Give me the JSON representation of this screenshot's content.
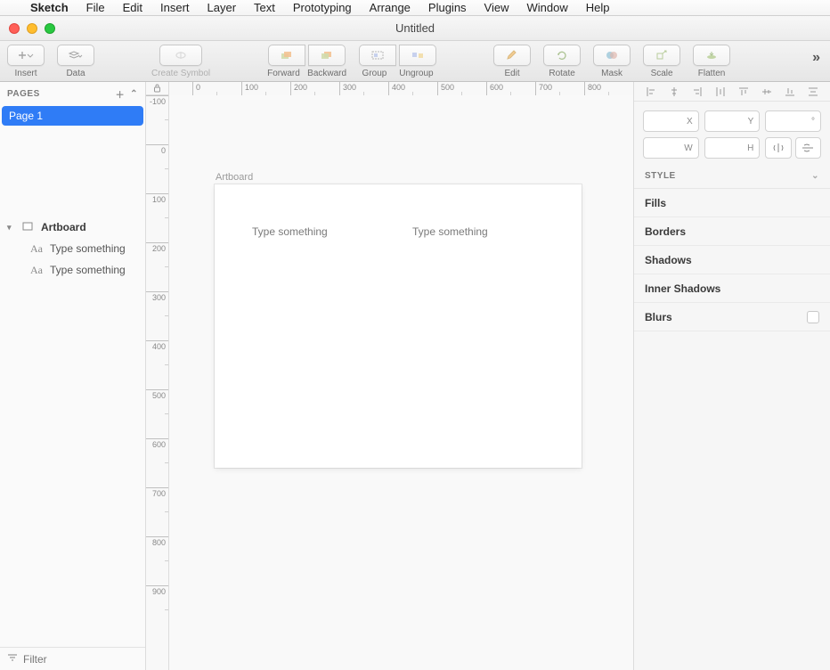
{
  "menubar": {
    "app": "Sketch",
    "items": [
      "File",
      "Edit",
      "Insert",
      "Layer",
      "Text",
      "Prototyping",
      "Arrange",
      "Plugins",
      "View",
      "Window",
      "Help"
    ]
  },
  "window": {
    "title": "Untitled"
  },
  "toolbar": {
    "insert": "Insert",
    "data": "Data",
    "create_symbol": "Create Symbol",
    "forward": "Forward",
    "backward": "Backward",
    "group": "Group",
    "ungroup": "Ungroup",
    "edit": "Edit",
    "rotate": "Rotate",
    "mask": "Mask",
    "scale": "Scale",
    "flatten": "Flatten",
    "overflow": "»"
  },
  "sidebar": {
    "pages_label": "PAGES",
    "page_items": [
      "Page 1"
    ],
    "layers": {
      "artboard": "Artboard",
      "children": [
        "Type something",
        "Type something"
      ]
    },
    "filter_placeholder": "Filter"
  },
  "ruler": {
    "h": [
      "0",
      "100",
      "200",
      "300",
      "400",
      "500",
      "600",
      "700",
      "800"
    ],
    "v": [
      "-100",
      "0",
      "100",
      "200",
      "300",
      "400",
      "500",
      "600",
      "700",
      "800",
      "900"
    ]
  },
  "canvas": {
    "artboard_label": "Artboard",
    "text1": "Type something",
    "text2": "Type something"
  },
  "inspector": {
    "pos": {
      "x": "X",
      "y": "Y",
      "deg": "°",
      "w": "W",
      "h": "H"
    },
    "style_label": "STYLE",
    "sections": [
      "Fills",
      "Borders",
      "Shadows",
      "Inner Shadows",
      "Blurs"
    ]
  }
}
